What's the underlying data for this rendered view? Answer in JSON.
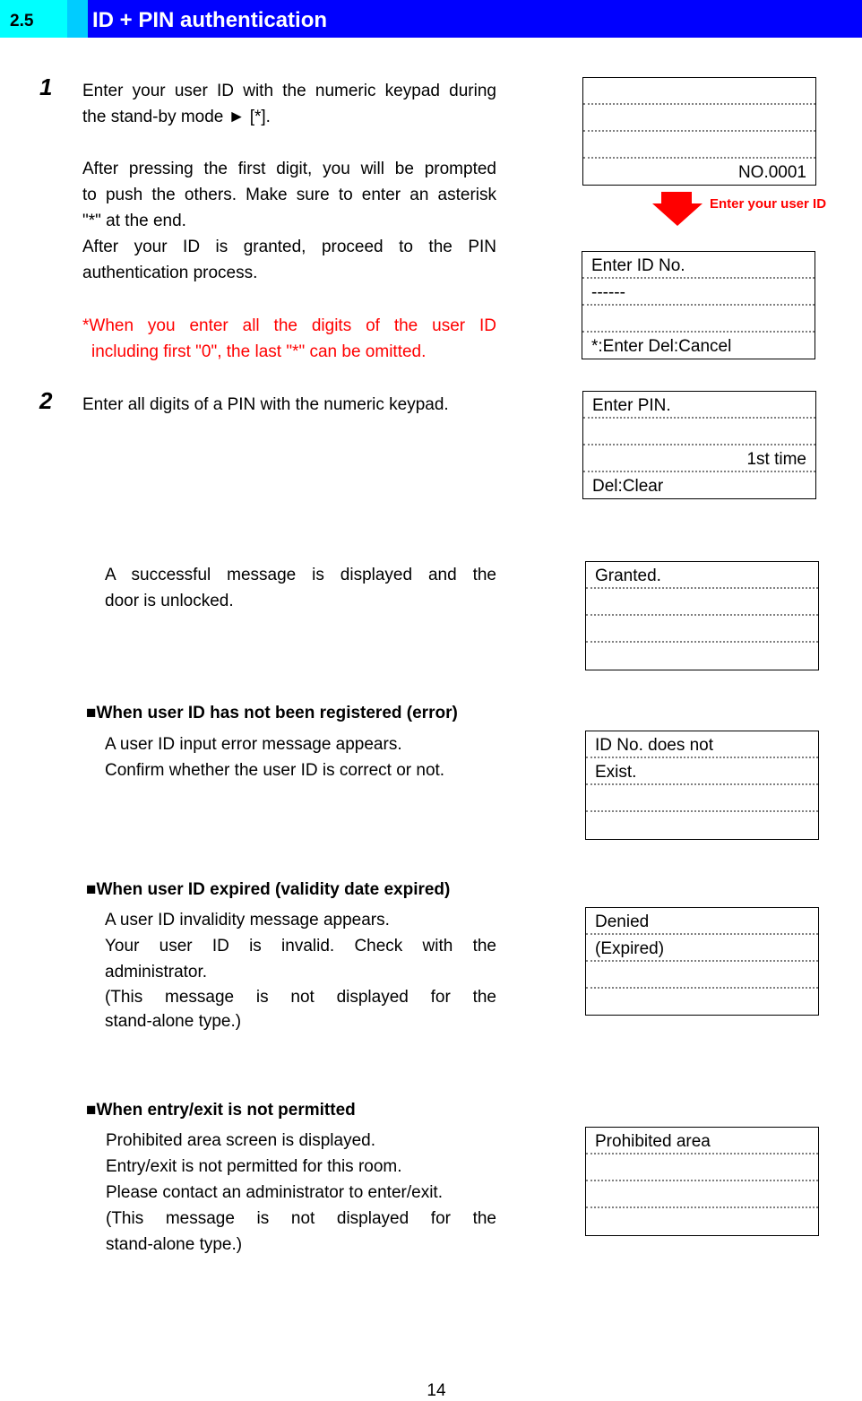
{
  "header": {
    "section_number": "2.5",
    "title": "ID + PIN authentication",
    "colors": {
      "number_bg": "#00ffff",
      "gap_bg": "#00ccff",
      "title_bg": "#0000ff",
      "title_text": "#ffffff"
    }
  },
  "steps": [
    {
      "number": "1",
      "lines_a": [
        "Enter your user ID with the numeric keypad during",
        "the stand-by mode ► [*]."
      ],
      "lines_b": [
        "After pressing the first digit, you will be prompted",
        "to push the others. Make sure to enter an asterisk",
        "\"*\" at the end.",
        "After your ID is granted, proceed to the PIN",
        "authentication process."
      ],
      "note_lines": [
        "*When you enter all the digits of the user ID",
        "including first \"0\", the last \"*\" can be omitted."
      ]
    },
    {
      "number": "2",
      "text": "Enter all digits of a PIN with the numeric keypad."
    }
  ],
  "success": {
    "lines": [
      "A successful message is displayed and the",
      "door is unlocked."
    ]
  },
  "cases": [
    {
      "heading": "When user ID has not been registered (error)",
      "lines": [
        "A user ID input error message appears.",
        "Confirm whether the user ID is correct or not."
      ]
    },
    {
      "heading": "When user ID expired (validity date expired)",
      "lines": [
        "A user ID invalidity message appears.",
        "Your user ID is invalid. Check with the",
        "administrator.",
        "(This message is not displayed for the",
        "stand-alone type.)"
      ]
    },
    {
      "heading": "When entry/exit is not permitted",
      "lines": [
        "Prohibited area screen is displayed.",
        "Entry/exit is not permitted for this room.",
        "Please contact an administrator to enter/exit.",
        "(This message is not displayed for the",
        "stand-alone type.)"
      ]
    }
  ],
  "bullet_glyph": "■",
  "screens": {
    "standby": [
      "",
      "",
      "",
      "NO.0001"
    ],
    "enter_id": [
      "Enter ID No.",
      "------",
      "",
      "*:Enter Del:Cancel"
    ],
    "enter_pin": [
      "Enter PIN.",
      "",
      "1st time",
      "Del:Clear"
    ],
    "granted": [
      "Granted.",
      "",
      "",
      ""
    ],
    "not_registered": [
      "ID No. does not",
      "Exist.",
      "",
      ""
    ],
    "expired": [
      "Denied",
      "(Expired)",
      "",
      ""
    ],
    "prohibited": [
      "Prohibited area",
      "",
      "",
      ""
    ]
  },
  "arrow_label": "Enter your user ID",
  "accent_red": "#ff0000",
  "page_number": "14"
}
